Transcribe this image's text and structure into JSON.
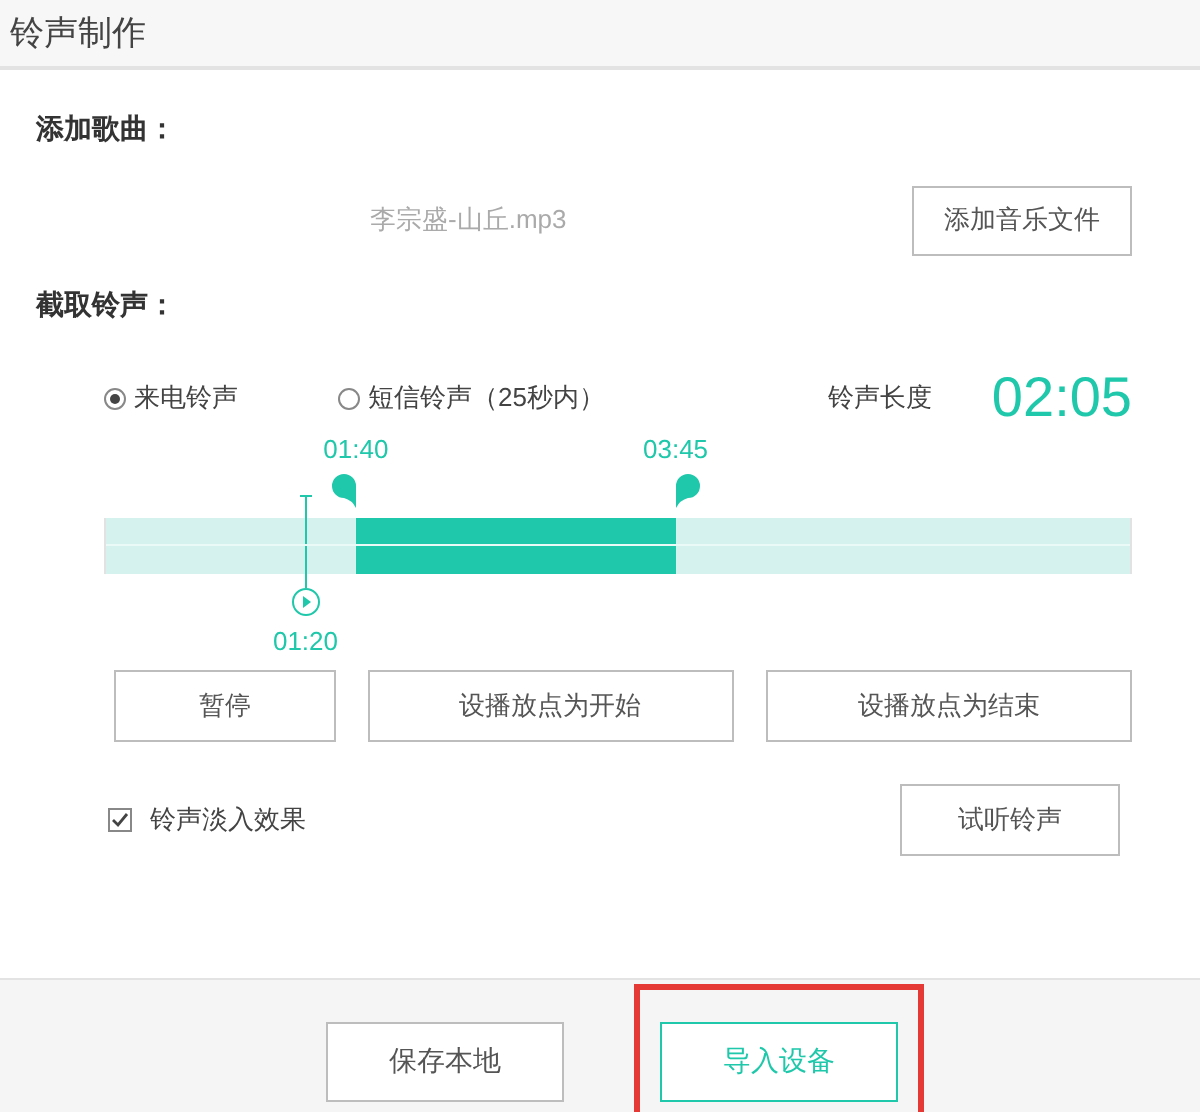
{
  "window": {
    "title": "铃声制作"
  },
  "add_song": {
    "heading": "添加歌曲：",
    "file_name": "李宗盛-山丘.mp3",
    "button": "添加音乐文件"
  },
  "clip": {
    "heading": "截取铃声：",
    "types": [
      {
        "label": "来电铃声",
        "selected": true
      },
      {
        "label": "短信铃声（25秒内）",
        "selected": false
      }
    ],
    "length_label": "铃声长度",
    "length_value": "02:05",
    "selection_start": {
      "label": "01:40",
      "level": 0.245
    },
    "selection_end": {
      "label": "03:45",
      "level": 0.556
    },
    "playhead": {
      "label": "01:20",
      "level": 0.196
    },
    "controls": [
      "暂停",
      "设播放点为开始",
      "设播放点为结束"
    ],
    "fade_in": {
      "label": "铃声淡入效果",
      "checked": true
    },
    "preview_button": "试听铃声"
  },
  "footer": {
    "buttons": [
      {
        "label": "保存本地",
        "kind": "default",
        "highlighted": false
      },
      {
        "label": "导入设备",
        "kind": "primary",
        "highlighted": true
      }
    ]
  }
}
